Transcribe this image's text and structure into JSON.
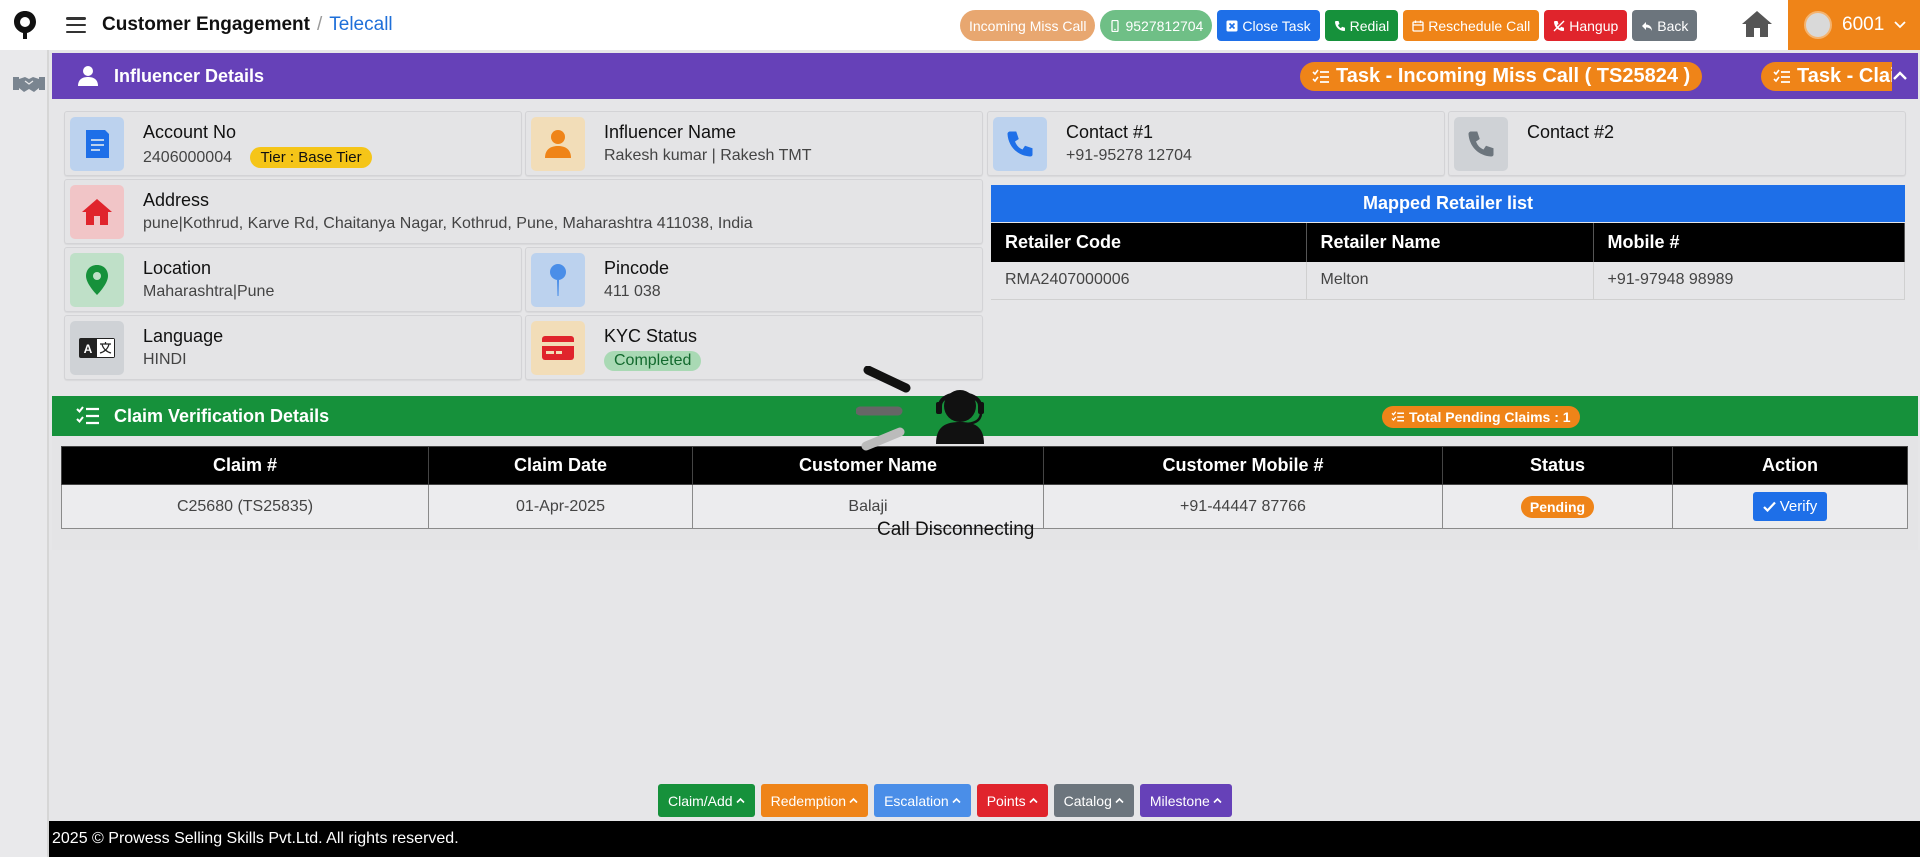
{
  "app": {
    "breadcrumb_title": "Customer Engagement",
    "breadcrumb_separator": "/",
    "breadcrumb_link": "Telecall"
  },
  "topbar": {
    "actions": [
      {
        "label": "Incoming Miss Call",
        "color": "#e8a770",
        "icon": "none",
        "pill": true
      },
      {
        "label": "9527812704",
        "color": "#6fbf86",
        "icon": "mobile-icon",
        "pill": true
      },
      {
        "label": "Close Task",
        "color": "#1e6fe8",
        "icon": "close-square-icon",
        "pill": false
      },
      {
        "label": "Redial",
        "color": "#16913b",
        "icon": "phone-redial-icon",
        "pill": false
      },
      {
        "label": "Reschedule Call",
        "color": "#ef8418",
        "icon": "calendar-icon",
        "pill": false
      },
      {
        "label": "Hangup",
        "color": "#e0242c",
        "icon": "phone-hangup-icon",
        "pill": false
      },
      {
        "label": "Back",
        "color": "#6c757d",
        "icon": "reply-icon",
        "pill": false
      }
    ],
    "user_code": "6001"
  },
  "influencer": {
    "section_title": "Influencer Details",
    "task_chip_1": "Task - Incoming Miss Call ( TS25824 )",
    "task_chip_2": "Task - Claim Ve",
    "account_label": "Account No",
    "account_value": "2406000004",
    "tier_badge": "Tier : Base Tier",
    "name_label": "Influencer Name",
    "name_value": "Rakesh kumar | Rakesh TMT",
    "contact1_label": "Contact #1",
    "contact1_value": "+91-95278 12704",
    "contact2_label": "Contact #2",
    "address_label": "Address",
    "address_value": "pune|Kothrud, Karve Rd, Chaitanya Nagar, Kothrud, Pune, Maharashtra 411038, India",
    "location_label": "Location",
    "location_value": "Maharashtra|Pune",
    "pincode_label": "Pincode",
    "pincode_value": "411 038",
    "language_label": "Language",
    "language_value": "HINDI",
    "kyc_label": "KYC Status",
    "kyc_value": "Completed"
  },
  "retailers": {
    "title": "Mapped Retailer list",
    "columns": [
      "Retailer Code",
      "Retailer Name",
      "Mobile #"
    ],
    "rows": [
      [
        "RMA2407000006",
        "Melton",
        "+91-97948 98989"
      ]
    ]
  },
  "claims": {
    "section_title": "Claim Verification Details",
    "pending_chip": "Total Pending Claims : 1",
    "columns": [
      "Claim #",
      "Claim Date",
      "Customer Name",
      "Customer Mobile #",
      "Status",
      "Action"
    ],
    "rows": [
      {
        "claim": "C25680 (TS25835)",
        "date": "01-Apr-2025",
        "customer": "Balaji",
        "mobile": "+91-44447 87766",
        "status": "Pending",
        "action": "Verify"
      }
    ]
  },
  "call_status": "Call Disconnecting",
  "bottom_menu": [
    {
      "label": "Claim/Add",
      "color": "#16913b"
    },
    {
      "label": "Redemption",
      "color": "#ef8418"
    },
    {
      "label": "Escalation",
      "color": "#4a8ee8"
    },
    {
      "label": "Points",
      "color": "#e0242c"
    },
    {
      "label": "Catalog",
      "color": "#6c757d"
    },
    {
      "label": "Milestone",
      "color": "#6641b8"
    }
  ],
  "footer": "2025 © Prowess Selling Skills Pvt.Ltd. All rights reserved."
}
